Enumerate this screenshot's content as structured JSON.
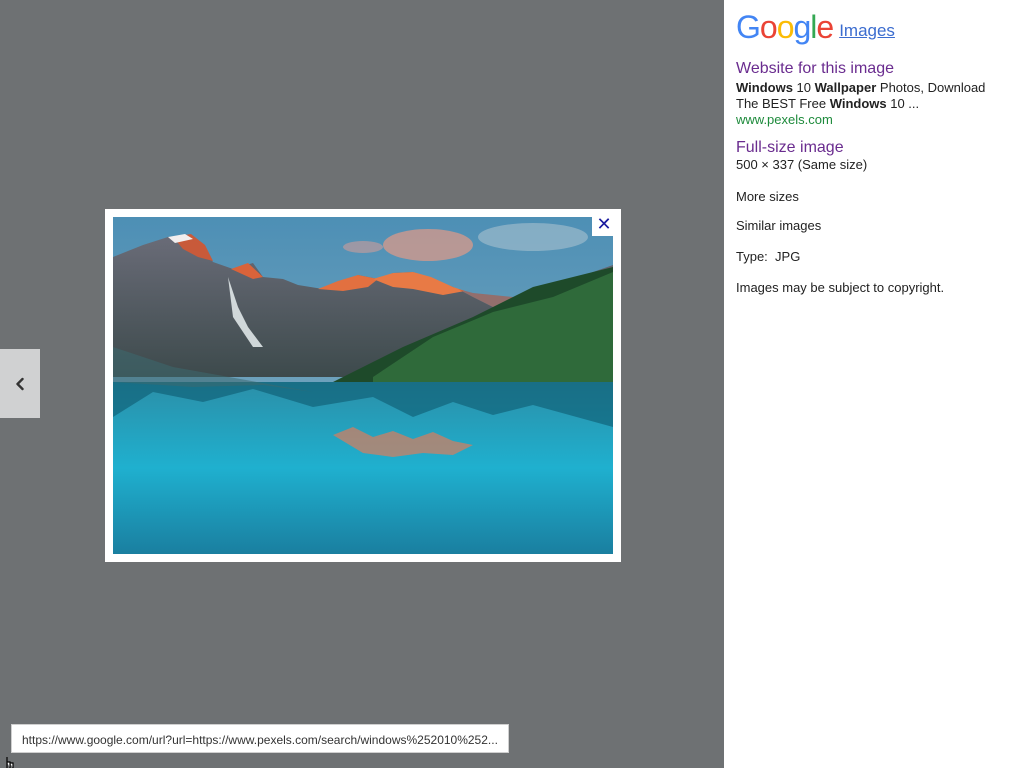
{
  "colors": {
    "viewer_bg": "#6e7173",
    "link_purple": "#6a2c8f",
    "link_blue": "#3b6ccf",
    "url_green": "#1d8a3b",
    "close_icon": "#1a1a9e"
  },
  "viewer": {
    "prev_icon": "chevron-left-icon",
    "close_icon": "close-icon",
    "image_subject": "mountain lake landscape"
  },
  "status_bar": {
    "url": "https://www.google.com/url?url=https://www.pexels.com/search/windows%252010%252..."
  },
  "panel": {
    "logo_letters": [
      "G",
      "o",
      "o",
      "g",
      "l",
      "e"
    ],
    "logo_colors": [
      "#4285F4",
      "#EA4335",
      "#FBBC05",
      "#4285F4",
      "#34A853",
      "#EA4335"
    ],
    "images_link": "Images",
    "website_heading": "Website for this image",
    "snippet_line1": [
      "Windows",
      " 10 ",
      "Wallpaper",
      " Photos, Download"
    ],
    "snippet_line2": [
      "The BEST Free ",
      "Windows",
      " 10 ..."
    ],
    "site_url": "www.pexels.com",
    "fullsize_heading": "Full-size image",
    "fullsize_info": "500 × 337 (Same size)",
    "more_sizes": "More sizes",
    "similar_images": "Similar images",
    "type_label": "Type:",
    "type_value": "JPG",
    "copyright": "Images may be subject to copyright."
  }
}
